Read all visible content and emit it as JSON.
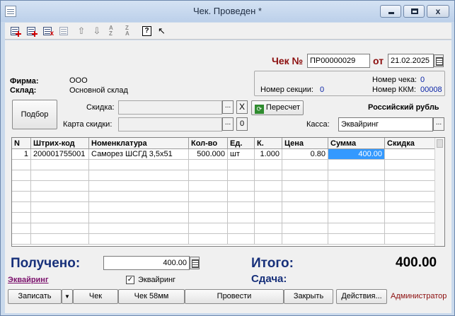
{
  "window": {
    "title": "Чек. Проведен *"
  },
  "header": {
    "check_label": "Чек №",
    "check_number": "ПР00000029",
    "date_label": "от",
    "date": "21.02.2025",
    "firm_label": "Фирма:",
    "firm_value": "ООО",
    "warehouse_label": "Склад:",
    "warehouse_value": "Основной склад",
    "receipt_no_label": "Номер чека:",
    "receipt_no": "0",
    "section_label": "Номер секции:",
    "section_no": "0",
    "kkm_label": "Номер ККМ:",
    "kkm_no": "00008"
  },
  "discount": {
    "select_button": "Подбор",
    "discount_label": "Скидка:",
    "discount_value": "",
    "card_label": "Карта скидки:",
    "card_value": "",
    "clear_symbol": "X",
    "card_zero": "0",
    "recalc_button": "Пересчет",
    "currency": "Российский рубль",
    "kassa_label": "Касса:",
    "kassa_value": "Эквайринг"
  },
  "table": {
    "columns": [
      "N",
      "Штрих-код",
      "Номенклатура",
      "Кол-во",
      "Ед.",
      "К.",
      "Цена",
      "Сумма",
      "Скидка"
    ],
    "rows": [
      {
        "n": "1",
        "barcode": "200001755001",
        "name": "Саморез ШСГД 3,5х51",
        "qty": "500.000",
        "unit": "шт",
        "k": "1.000",
        "price": "0.80",
        "sum": "400.00",
        "discount": ""
      }
    ]
  },
  "footer": {
    "received_label": "Получено:",
    "received_value": "400.00",
    "total_label": "Итого:",
    "total_value": "400.00",
    "change_label": "Сдача:",
    "acquiring_link": "Эквайринг",
    "acquiring_checkbox_label": "Эквайринг",
    "acquiring_checked": "✓",
    "buttons": {
      "save": "Записать",
      "dropdown": "▼",
      "check": "Чек",
      "check58": "Чек 58мм",
      "post": "Провести",
      "close": "Закрыть",
      "actions": "Действия..."
    },
    "user": "Администратор"
  },
  "titlebar_buttons": {
    "close_glyph": "x"
  },
  "toolbar": {
    "icons": [
      "add-row-icon",
      "add-row-copy-icon",
      "delete-row-icon",
      "edit-row-icon",
      "move-up-icon",
      "move-down-icon",
      "sort-ascending-icon",
      "sort-descending-icon",
      "help-icon",
      "pointer-help-icon"
    ],
    "up_arrow": "⇧",
    "down_arrow": "⇩",
    "sort_asc": [
      "A",
      "Z"
    ],
    "sort_desc": [
      "Z",
      "A"
    ],
    "help": "?",
    "pointer": "↖"
  },
  "colors": {
    "accent_red": "#8b0d0d",
    "link_purple": "#7a0f6b",
    "selection": "#3399ff",
    "big_label_blue": "#17307a"
  }
}
